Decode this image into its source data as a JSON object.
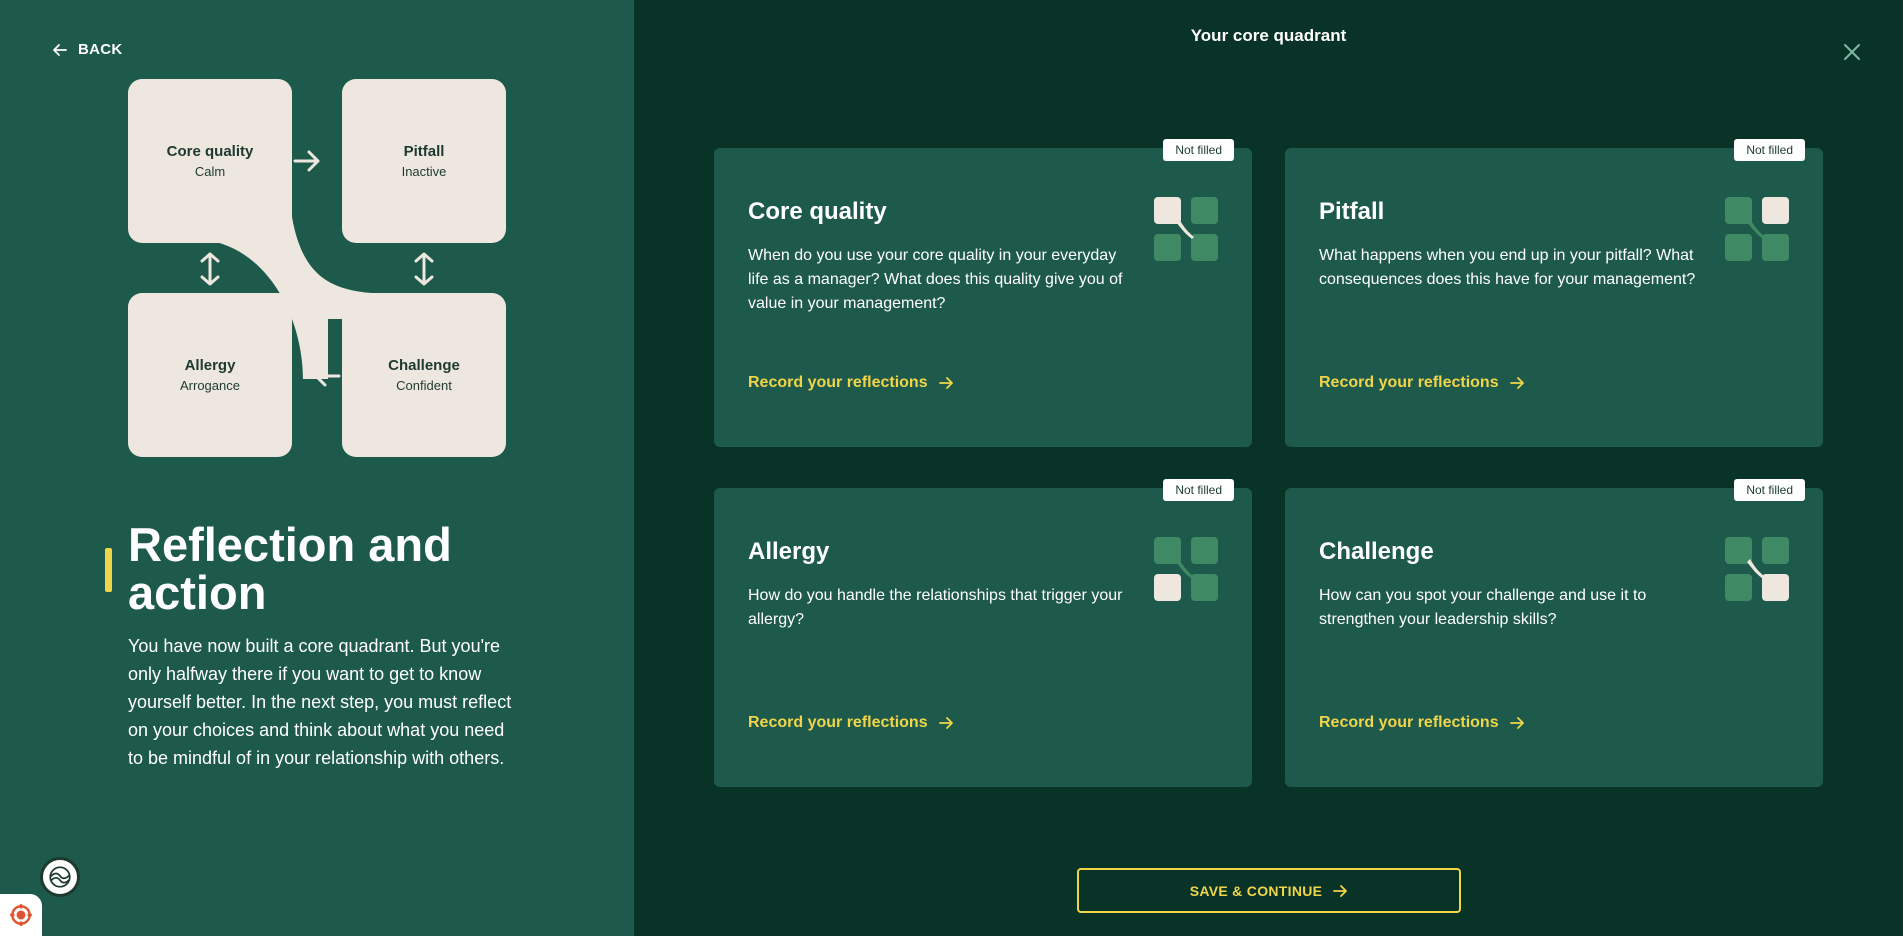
{
  "nav": {
    "back_label": "BACK"
  },
  "quadrant": {
    "core_quality": {
      "title": "Core quality",
      "value": "Calm"
    },
    "pitfall": {
      "title": "Pitfall",
      "value": "Inactive"
    },
    "allergy": {
      "title": "Allergy",
      "value": "Arrogance"
    },
    "challenge": {
      "title": "Challenge",
      "value": "Confident"
    }
  },
  "intro": {
    "heading": "Reflection and action",
    "text": "You have now built a core quadrant. But you're only halfway there if you want to get to know yourself better. In the next step, you must reflect on your choices and think about what you need to be mindful of in your relationship with others."
  },
  "main": {
    "title": "Your core quadrant",
    "cards": [
      {
        "status": "Not filled",
        "title": "Core quality",
        "question": "When do you use your core quality in your everyday life as a manager? What does this quality give you of value in your management?",
        "link": "Record your reflections"
      },
      {
        "status": "Not filled",
        "title": "Pitfall",
        "question": "What happens when you end up in your pitfall? What consequences does this have for your management?",
        "link": "Record your reflections"
      },
      {
        "status": "Not filled",
        "title": "Allergy",
        "question": "How do you handle the relationships that trigger your allergy?",
        "link": "Record your reflections"
      },
      {
        "status": "Not filled",
        "title": "Challenge",
        "question": "How can you spot your challenge and use it to strengthen your leadership skills?",
        "link": "Record your reflections"
      }
    ],
    "save_label": "SAVE & CONTINUE"
  },
  "colors": {
    "left_bg": "#1e5a4b",
    "right_bg": "#0a3327",
    "card_bg": "#1e5a4b",
    "accent": "#f0d54a",
    "box_fill": "#ede7df",
    "icon_tile": "#3f8a64"
  }
}
